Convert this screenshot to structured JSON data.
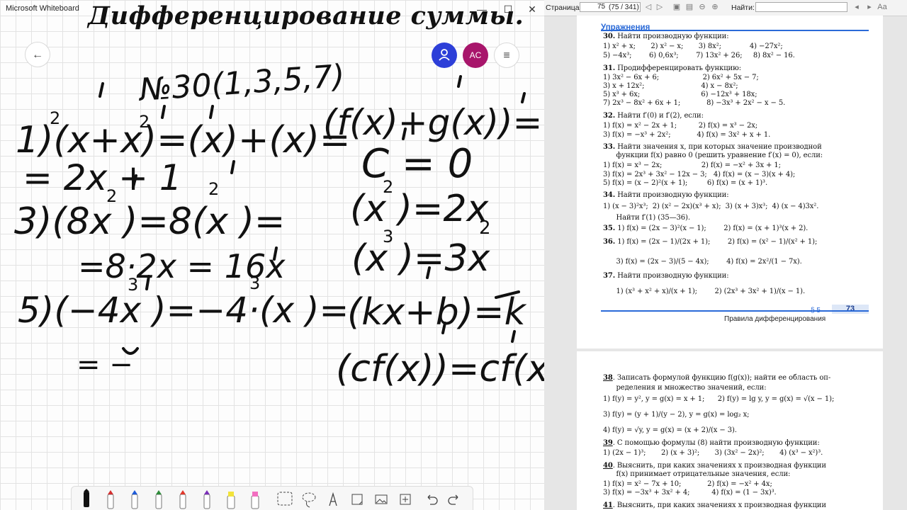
{
  "whiteboard": {
    "app_title": "Microsoft Whiteboard",
    "heading": "Дифференцирование суммы.",
    "window_controls": {
      "minimize": "—",
      "maximize": "☐",
      "close": "✕"
    },
    "buttons": {
      "back": "←",
      "menu": "≡",
      "avatar_initials": "AC"
    },
    "ink_text": {
      "task_ref": "№30(1,3,5,7)",
      "line_1a": "1) (x²+x)′ = (x²)′ + (x)′ =",
      "line_1b": "= 2x + 1",
      "line_3a": "3) (8x²)′ = 8(x²)′ =",
      "line_3b": "= 8·2x = 16x",
      "line_5a": "5) (−4x³)′ = −4·(x³)′ =",
      "line_5b": "= −",
      "rule_sum": "(f(x)+g(x))′ = f′(x)+g′(x)",
      "rule_const": "C′ = 0",
      "rule_x2": "(x²)′ = 2x",
      "rule_x3": "(x³)′ = 3x²",
      "rule_linear": "(kx+b)′ = k",
      "rule_cf": "(cf(x))′ = cf′(x)"
    },
    "toolbar_tools": [
      "pen-black",
      "pen-red",
      "pen-blue",
      "pen-green",
      "pen-red-2",
      "pen-purple",
      "highlighter-yellow",
      "highlighter-pink",
      "lasso-select",
      "lasso",
      "text",
      "sticky-note",
      "image",
      "insert",
      "undo",
      "redo"
    ]
  },
  "viewer": {
    "page_label": "Страница:",
    "page_value": "75",
    "page_info": "(75 / 341)",
    "find_label": "Найти:",
    "page73": {
      "section_title": "Упражнения",
      "footer_section": "§ 5",
      "footer_page": "73",
      "footer_caption": "Правила дифференцирования",
      "lines": [
        "30. Найти производную функции:",
        "1) x² + x;       2) x² − x;       3) 8x²;             4) −27x²;",
        "5) −4x³;        6) 0,6x³;        7) 13x² + 26;     8) 8x² − 16.",
        "31. Продифференцировать функцию:",
        "1) 3x² − 6x + 6;                    2) 6x² + 5x − 7;",
        "3) x + 12x²;                          4) x − 8x²;",
        "5) x³ + 6x;                            6) −12x³ + 18x;",
        "7) 2x³ − 8x² + 6x + 1;            8) −3x³ + 2x² − x − 5.",
        "32. Найти f′(0) и f′(2), если:",
        "1) f(x) = x² − 2x + 1;          2) f(x) = x³ − 2x;",
        "3) f(x) = −x³ + 2x²;            4) f(x) = 3x² + x + 1.",
        "33. Найти значения x, при которых значение производной",
        "      функции f(x) равно 0 (решить уравнение f′(x) = 0), если:",
        "1) f(x) = x³ − 2x;                  2) f(x) = −x² + 3x + 1;",
        "3) f(x) = 2x³ + 3x² − 12x − 3;   4) f(x) = (x − 3)(x + 4);",
        "5) f(x) = (x − 2)²(x + 1);         6) f(x) = (x + 1)³.",
        "34. Найти производную функции:",
        "1) (x − 3)²x³;  2) (x² − 2x)(x³ + x);  3) (x + 3)x³;  4) (x − 4)3x².",
        "      Найти f′(1) (35—36).",
        "35. 1) f(x) = (2x − 3)²(x − 1);        2) f(x) = (x + 1)³(x + 2).",
        "36. 1) f(x) = (2x − 1)/(2x + 1);        2) f(x) = (x² − 1)/(x² + 1);",
        "      3) f(x) = (2x − 3)/(5 − 4x);        4) f(x) = 2x²/(1 − 7x).",
        "37. Найти производную функции:",
        "      1) (x³ + x² + x)/(x + 1);        2) (2x³ + 3x² + 1)/(x − 1)."
      ]
    },
    "page74": {
      "lines": [
        "38. Записать формулой функцию f(g(x)); найти ее область оп-",
        "      ределения и множество значений, если:",
        "1) f(y) = y², y = g(x) = x + 1;      2) f(y) = lg y, y = g(x) = √(x − 1);",
        "3) f(y) = (y + 1)/(y − 2), y = g(x) = log₂ x;",
        "4) f(y) = √y, y = g(x) = (x + 2)/(x − 3).",
        "39. С помощью формулы (8) найти производную функции:",
        "1) (2x − 1)³;       2) (x + 3)²;       3) (3x² − 2x)²;       4) (x³ − x²)³.",
        "40. Выяснить, при каких значениях x производная функции",
        "      f(x) принимает отрицательные значения, если:",
        "1) f(x) = x² − 7x + 10;            2) f(x) = −x² + 4x;",
        "3) f(x) = −3x³ + 3x² + 4;          4) f(x) = (1 − 3x)³.",
        "41. Выяснить, при каких значениях x производная функции"
      ]
    }
  }
}
